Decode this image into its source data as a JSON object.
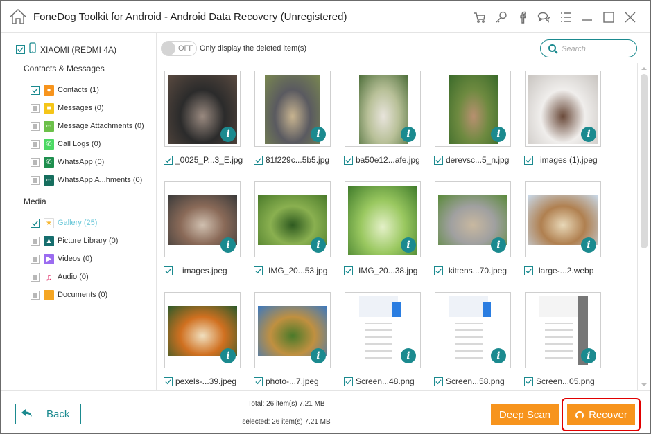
{
  "window": {
    "title": "FoneDog Toolkit for Android - Android Data Recovery (Unregistered)",
    "titlebar_icons": [
      "cart-icon",
      "key-icon",
      "facebook-icon",
      "chat-icon",
      "menu-icon",
      "minimize-icon",
      "maximize-icon",
      "close-icon"
    ]
  },
  "sidebar": {
    "device": {
      "label": "XIAOMI (REDMI 4A)",
      "checked": true
    },
    "sections": [
      {
        "title": "Contacts & Messages",
        "items": [
          {
            "label": "Contacts (1)",
            "checked": true,
            "icon": "contacts-icon",
            "color": "#f7941d"
          },
          {
            "label": "Messages (0)",
            "checked": false,
            "icon": "messages-icon",
            "color": "#f5c518"
          },
          {
            "label": "Message Attachments (0)",
            "checked": false,
            "icon": "attachment-icon",
            "color": "#6cc04a"
          },
          {
            "label": "Call Logs (0)",
            "checked": false,
            "icon": "phone-icon",
            "color": "#4cd964"
          },
          {
            "label": "WhatsApp (0)",
            "checked": false,
            "icon": "whatsapp-icon",
            "color": "#1e8f4e"
          },
          {
            "label": "WhatsApp A...hments (0)",
            "checked": false,
            "icon": "whatsapp-attachment-icon",
            "color": "#166e5e"
          }
        ]
      },
      {
        "title": "Media",
        "items": [
          {
            "label": "Gallery (25)",
            "checked": true,
            "active": true,
            "icon": "star-icon",
            "color": "#f7b733"
          },
          {
            "label": "Picture Library (0)",
            "checked": false,
            "icon": "picture-icon",
            "color": "#166e6e"
          },
          {
            "label": "Videos (0)",
            "checked": false,
            "icon": "video-icon",
            "color": "#9b6cf0"
          },
          {
            "label": "Audio (0)",
            "checked": false,
            "icon": "audio-icon",
            "color": "#e0306a"
          },
          {
            "label": "Documents (0)",
            "checked": false,
            "icon": "folder-icon",
            "color": "#f5a623"
          }
        ]
      }
    ]
  },
  "toolbar": {
    "toggle_state": "OFF",
    "toggle_label": "Only display the deleted item(s)",
    "search_placeholder": "Search"
  },
  "files": [
    {
      "name": "_0025_P...3_E.jpg",
      "checked": true,
      "colors": [
        "#5a4a40",
        "#2b2b2b",
        "#9a8a80"
      ]
    },
    {
      "name": "81f229c...5b5.jpg",
      "checked": true,
      "colors": [
        "#7a8850",
        "#5a5a60",
        "#c8b490"
      ]
    },
    {
      "name": "ba50e12...afe.jpg",
      "checked": true,
      "colors": [
        "#4d6e3a",
        "#b8c098",
        "#e8e4dc"
      ]
    },
    {
      "name": "derevsc...5_n.jpg",
      "checked": true,
      "colors": [
        "#3a6a2a",
        "#6e8a40",
        "#b89070"
      ]
    },
    {
      "name": "images (1).jpeg",
      "checked": true,
      "colors": [
        "#c8c4c0",
        "#f0eeec",
        "#6a4a3a"
      ]
    },
    {
      "name": "images.jpeg",
      "checked": true,
      "colors": [
        "#3a3a3a",
        "#8a6a58",
        "#d0c0b0"
      ]
    },
    {
      "name": "IMG_20...53.jpg",
      "checked": true,
      "colors": [
        "#4a7a2a",
        "#8ab050",
        "#2e5a20"
      ]
    },
    {
      "name": "IMG_20...38.jpg",
      "checked": true,
      "colors": [
        "#3e7a2a",
        "#9ac860",
        "#e4f0c8"
      ]
    },
    {
      "name": "kittens...70.jpeg",
      "checked": true,
      "colors": [
        "#5a8a3a",
        "#a0a0a0",
        "#c8b8a0"
      ]
    },
    {
      "name": "large-...2.webp",
      "checked": true,
      "colors": [
        "#c8d8e8",
        "#b08050",
        "#e8d8b8"
      ]
    },
    {
      "name": "pexels-...39.jpeg",
      "checked": true,
      "colors": [
        "#2a5a2a",
        "#d07020",
        "#f0e0c0"
      ]
    },
    {
      "name": "photo-...7.jpeg",
      "checked": true,
      "colors": [
        "#3a78c0",
        "#c09040",
        "#4a7a2a"
      ]
    },
    {
      "name": "Screen...48.png",
      "checked": true,
      "colors": [
        "#ffffff",
        "#2a7de1",
        "#eef2f8"
      ]
    },
    {
      "name": "Screen...58.png",
      "checked": true,
      "colors": [
        "#ffffff",
        "#2a7de1",
        "#eef2f8"
      ]
    },
    {
      "name": "Screen...05.png",
      "checked": true,
      "colors": [
        "#ffffff",
        "#6a6a6a",
        "#f4f4f4"
      ]
    }
  ],
  "footer": {
    "back_label": "Back",
    "total_text": "Total: 26 item(s) 7.21 MB",
    "selected_text": "selected: 26 item(s) 7.21 MB",
    "deep_scan_label": "Deep Scan",
    "recover_label": "Recover"
  },
  "colors": {
    "accent": "#1b8a8f",
    "orange": "#f7941d",
    "highlight": "#e10000"
  }
}
